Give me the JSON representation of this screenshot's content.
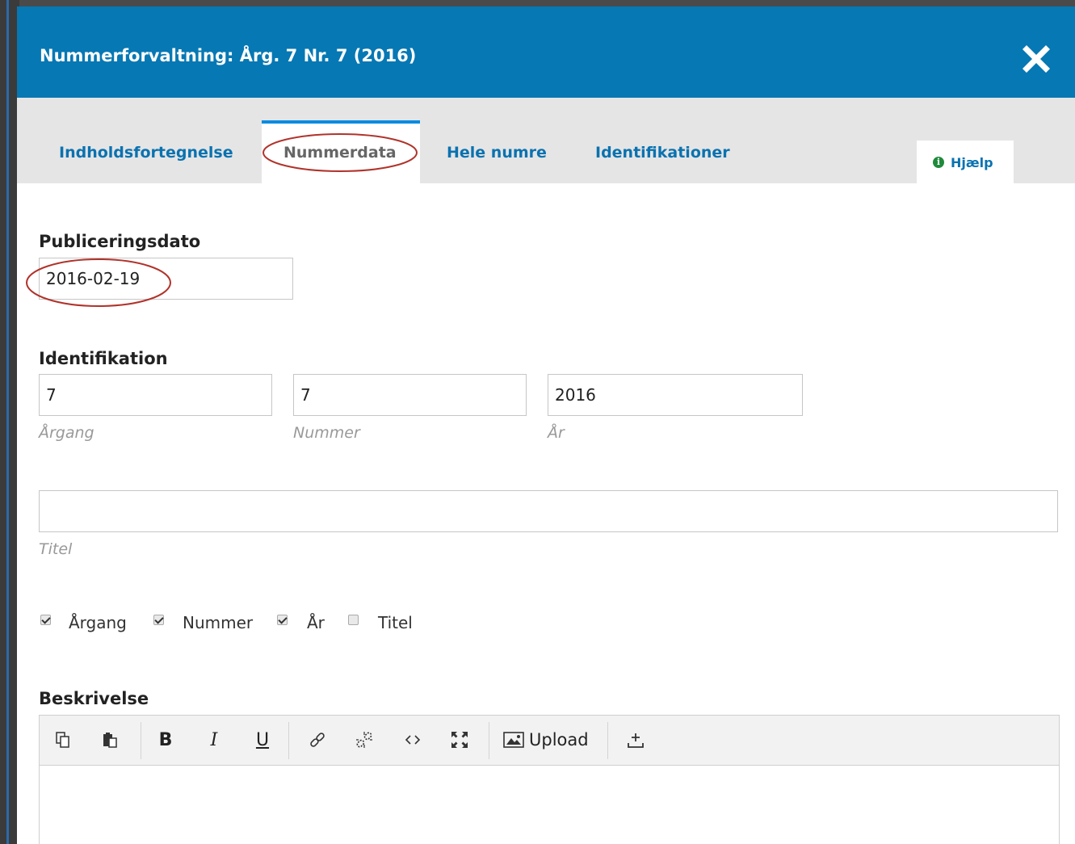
{
  "modal": {
    "title": "Nummerforvaltning: Årg. 7 Nr. 7 (2016)",
    "close_icon": "close-icon"
  },
  "tabs": [
    {
      "label": "Indholdsfortegnelse",
      "active": false
    },
    {
      "label": "Nummerdata",
      "active": true
    },
    {
      "label": "Hele numre",
      "active": false
    },
    {
      "label": "Identifikationer",
      "active": false
    }
  ],
  "help": {
    "label": "Hjælp",
    "icon": "info-icon"
  },
  "form": {
    "publish_date": {
      "label": "Publiceringsdato",
      "value": "2016-02-19"
    },
    "identification": {
      "label": "Identifikation",
      "volume": {
        "value": "7",
        "hint": "Årgang"
      },
      "number": {
        "value": "7",
        "hint": "Nummer"
      },
      "year": {
        "value": "2016",
        "hint": "År"
      }
    },
    "title": {
      "value": "",
      "hint": "Titel"
    },
    "show": [
      {
        "label": "Årgang",
        "checked": true
      },
      {
        "label": "Nummer",
        "checked": true
      },
      {
        "label": "År",
        "checked": true
      },
      {
        "label": "Titel",
        "checked": false
      }
    ],
    "description": {
      "label": "Beskrivelse",
      "toolbar": {
        "bold": "B",
        "italic": "I",
        "underline": "U",
        "upload": "Upload"
      }
    }
  },
  "colors": {
    "header": "#0678b4",
    "tab_link": "#0a72b0",
    "annotation": "#b0332b"
  }
}
